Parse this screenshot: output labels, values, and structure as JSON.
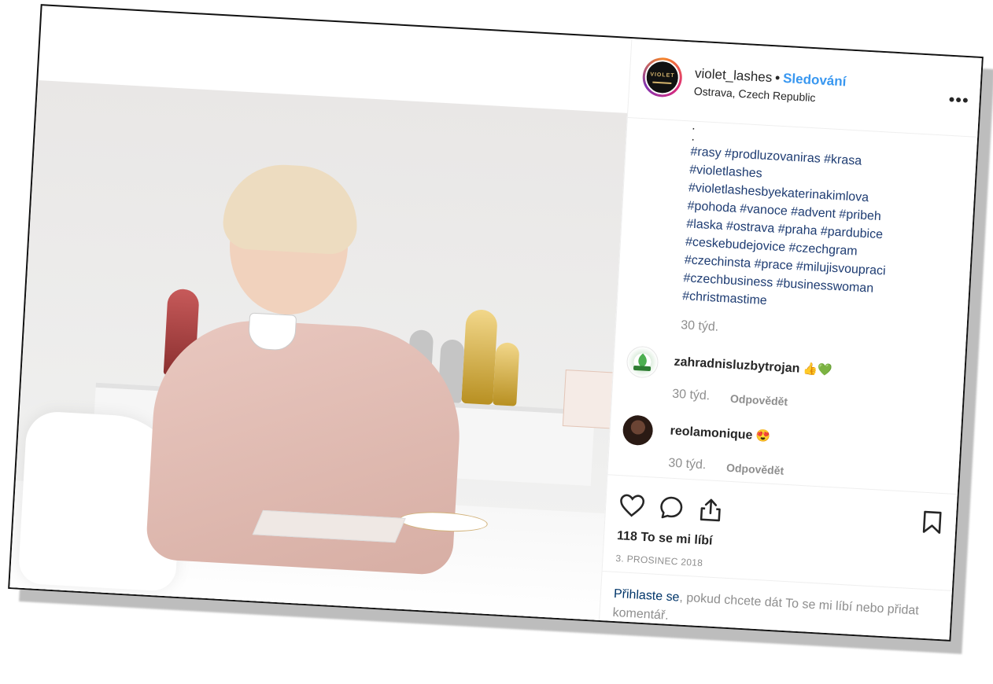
{
  "post": {
    "username": "violet_lashes",
    "separator": "•",
    "follow_label": "Sledování",
    "location": "Ostrava, Czech Republic",
    "more_label": "•••",
    "avatar_text": "VIOLET",
    "caption_dots": [
      ".",
      "."
    ],
    "hashtag_lines": [
      "#rasy #prodluzovaniras #krasa",
      "#violetlashes",
      "#violetlashesbyekaterinakimlova",
      "#pohoda #vanoce #advent #pribeh",
      "#laska #ostrava #praha #pardubice",
      "#ceskebudejovice #czechgram",
      "#czechinsta #prace #milujisvoupraci",
      "#czechbusiness #businesswoman",
      "#christmastime"
    ],
    "caption_time": "30 týd.",
    "comments": [
      {
        "user": "zahradnisluzbytrojan",
        "emoji": "👍💚",
        "time": "30 týd.",
        "reply": "Odpovědět"
      },
      {
        "user": "reolamonique",
        "emoji": "😍",
        "time": "30 týd.",
        "reply": "Odpovědět"
      }
    ],
    "likes": "118 To se mi líbí",
    "date": "3. PROSINEC 2018",
    "login_link": "Přihlaste se",
    "login_rest": ", pokud chcete dát To se mi líbí nebo přidat komentář."
  },
  "colors": {
    "link_blue": "#3897f0",
    "hashtag": "#1e3c72",
    "muted": "#8e8e8e",
    "text": "#262626"
  },
  "icons": {
    "like": "heart-icon",
    "comment": "comment-bubble-icon",
    "share": "share-icon",
    "save": "bookmark-icon"
  }
}
